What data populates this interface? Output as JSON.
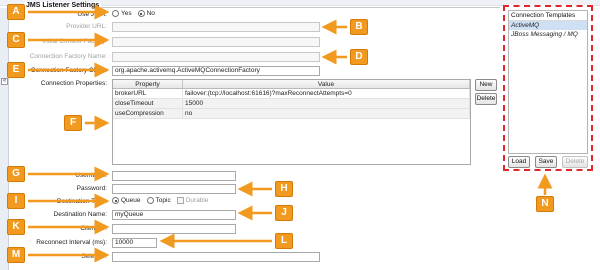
{
  "group_title": "JMS Listener Settings",
  "use_jndi": {
    "label": "Use JNDI:",
    "yes": "Yes",
    "no": "No",
    "selected": "No"
  },
  "provider_url": {
    "label": "Provider URL:",
    "value": ""
  },
  "initial_context_factory": {
    "label": "Initial Context Factory:",
    "value": ""
  },
  "connection_factory_name": {
    "label": "Connection Factory Name:",
    "value": ""
  },
  "connection_factory_class": {
    "label": "Connection Factory Class:",
    "value": "org.apache.activemq.ActiveMQConnectionFactory"
  },
  "connection_properties": {
    "label": "Connection Properties:",
    "columns": [
      "Property",
      "Value"
    ],
    "rows": [
      {
        "property": "brokerURL",
        "value": "failover:(tcp://localhost:61616)?maxReconnectAttempts=0"
      },
      {
        "property": "closeTimeout",
        "value": "15000"
      },
      {
        "property": "useCompression",
        "value": "no"
      }
    ],
    "new_button": "New",
    "delete_button": "Delete"
  },
  "username": {
    "label": "Username:",
    "value": ""
  },
  "password": {
    "label": "Password:",
    "value": ""
  },
  "destination_type": {
    "label": "Destination Type:",
    "queue": "Queue",
    "topic": "Topic",
    "durable": "Durable",
    "selected": "Queue"
  },
  "destination_name": {
    "label": "Destination Name:",
    "value": "myQueue"
  },
  "client_id": {
    "label": "Client ID:",
    "value": ""
  },
  "reconnect_interval": {
    "label": "Reconnect Interval (ms):",
    "value": "10000"
  },
  "selector": {
    "label": "Selector:",
    "value": ""
  },
  "connection_templates": {
    "title": "Connection Templates",
    "items": [
      "ActiveMQ",
      "JBoss Messaging / MQ"
    ],
    "selected": "ActiveMQ",
    "load_button": "Load",
    "save_button": "Save",
    "delete_button": "Delete"
  },
  "callouts": [
    "A",
    "B",
    "C",
    "D",
    "E",
    "F",
    "G",
    "H",
    "I",
    "J",
    "K",
    "L",
    "M",
    "N"
  ],
  "colors": {
    "callout": "#f29a1f",
    "highlight_border": "#e0262b",
    "selection": "#cfe0f4"
  },
  "sidebar": {
    "collapse_glyph": "«"
  }
}
